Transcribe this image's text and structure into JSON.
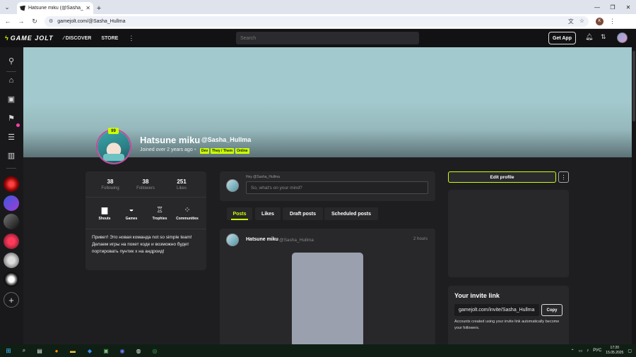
{
  "browser": {
    "tab_title": "Hatsune miku (@Sasha_Hullma",
    "tab_close": "✕",
    "new_tab": "+",
    "url": "gamejolt.com/@Sasha_Hullma",
    "profile_initial": "K"
  },
  "nav": {
    "logo": "GAME JOLT",
    "discover": "DISCOVER",
    "store": "STORE",
    "search_placeholder": "Search",
    "get_app": "Get App"
  },
  "profile": {
    "display_name": "Hatsune miku",
    "username": "@Sasha_Hullma",
    "joined": "Joined over 2 years ago",
    "separator": "•",
    "crown_label": "99",
    "tags": [
      "Dev",
      "They / Them",
      "Online"
    ]
  },
  "stats": [
    {
      "value": "38",
      "label": "Following"
    },
    {
      "value": "38",
      "label": "Followers"
    },
    {
      "value": "251",
      "label": "Likes"
    }
  ],
  "quick_actions": [
    {
      "label": "Shouts",
      "icon": "shouts-icon"
    },
    {
      "label": "Games",
      "icon": "gamepad-icon"
    },
    {
      "label": "Trophies",
      "icon": "trophy-icon"
    },
    {
      "label": "Communities",
      "icon": "communities-icon"
    }
  ],
  "bio": "Привет! Это новая команда not so simple team! Делаем игры на покет коде и возможно будет портировать пунтик x на андроид!",
  "composer": {
    "label": "Hey @Sasha_Hullma",
    "placeholder": "So, what's on your mind?"
  },
  "tabs": [
    "Posts",
    "Likes",
    "Draft posts",
    "Scheduled posts"
  ],
  "post": {
    "author": "Hatsune miku",
    "username": "@Sasha_Hullma",
    "time": "2 hours"
  },
  "right": {
    "edit_profile": "Edit profile",
    "more": "⋮",
    "invite_title": "Your invite link",
    "invite_link": "gamejolt.com/invite/Sasha_Hullma",
    "copy": "Copy",
    "invite_note": "Accounts created using your invite link automatically become your followers."
  },
  "taskbar": {
    "lang": "РУС",
    "time": "17:20",
    "date": "15.05.2025"
  },
  "colors": {
    "accent": "#ccff00",
    "header_bg": "#a2c9cd",
    "page_bg": "#1e1e21",
    "card_bg": "#28282b"
  }
}
